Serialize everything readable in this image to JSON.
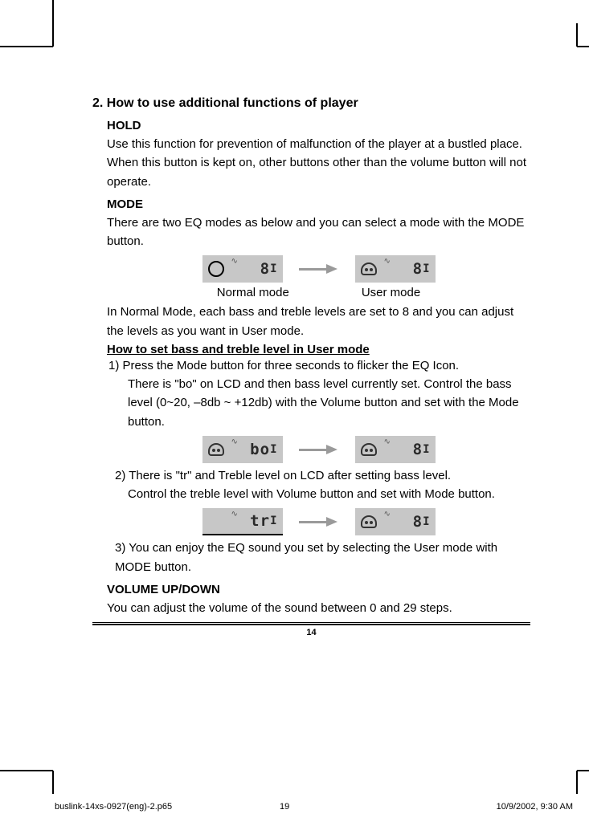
{
  "section": {
    "title": "2. How to use additional functions of player"
  },
  "hold": {
    "title": "HOLD",
    "p1": "Use this function for prevention of malfunction of the player at a bustled place.",
    "p2": "When this button is kept on, other buttons other than the volume button will not operate."
  },
  "mode": {
    "title": "MODE",
    "intro": "There are two EQ modes as below and you can select a mode with the MODE button.",
    "normal_label": "Normal mode",
    "user_label": "User mode",
    "desc": "In Normal Mode, each bass and treble levels are set to 8 and you can adjust the levels as you want in User mode.",
    "howto_title": "How to set bass and treble level in User mode",
    "step1a": "1) Press the Mode button for three seconds to flicker the EQ Icon.",
    "step1b": "There is \"bo\" on LCD and then bass level currently set. Control the bass level (0~20, –8db ~ +12db) with the Volume button and set with the Mode button.",
    "step2a": "2) There is \"tr\" and Treble level on LCD after setting bass level.",
    "step2b": "Control the treble level with Volume button and set with Mode button.",
    "step3": "3) You can enjoy the EQ sound you set by selecting the User mode with MODE button."
  },
  "lcd": {
    "eight": "8",
    "bo": "bo",
    "tr": "tr",
    "sig": "I"
  },
  "volume": {
    "title": "VOLUME UP/DOWN",
    "desc": "You can adjust the volume of the sound between 0 and 29 steps."
  },
  "page_number": "14",
  "footer": {
    "file": "buslink-14xs-0927(eng)-2.p65",
    "page": "19",
    "datetime": "10/9/2002, 9:30 AM"
  }
}
